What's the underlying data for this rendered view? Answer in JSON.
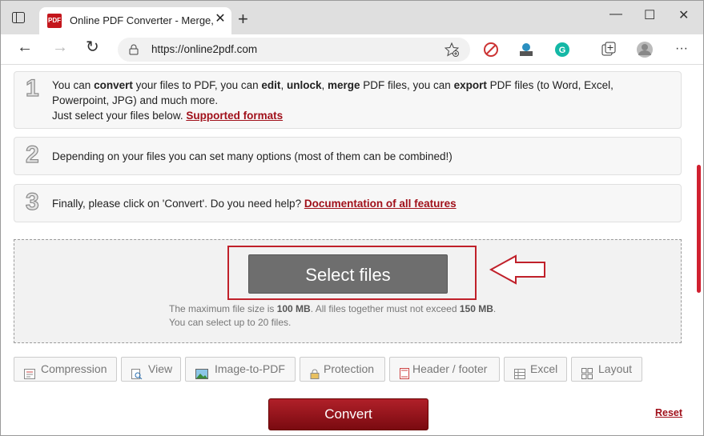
{
  "browser": {
    "tab_title": "Online PDF Converter - Merge, c",
    "favicon_text": "PDF",
    "url": "https://online2pdf.com"
  },
  "steps": [
    {
      "number": "1",
      "t1": "You can ",
      "b1": "convert",
      "t2": " your files to PDF, you can ",
      "b2": "edit",
      "t3": ", ",
      "b3": "unlock",
      "t4": ", ",
      "b4": "merge",
      "t5": " PDF files, you can ",
      "b5": "export",
      "t6": " PDF files (to Word, Excel,",
      "line2": "Powerpoint, JPG) and much more.",
      "line3": "Just select your files below. ",
      "link": "Supported formats"
    },
    {
      "number": "2",
      "text": "Depending on your files you can set many options (most of them can be combined!)"
    },
    {
      "number": "3",
      "text": "Finally, please click on 'Convert'. Do you need help? ",
      "link": "Documentation of all features"
    }
  ],
  "upload": {
    "button_label": "Select files",
    "info1_a": "The maximum file size is ",
    "info1_b": "100 MB",
    "info1_c": ". All files together must not exceed ",
    "info1_d": "150 MB",
    "info1_e": ".",
    "info2": "You can select up to 20 files."
  },
  "options": [
    {
      "label": "Compression",
      "icon": "compression-icon"
    },
    {
      "label": "View",
      "icon": "view-icon"
    },
    {
      "label": "Image-to-PDF",
      "icon": "image-icon"
    },
    {
      "label": "Protection",
      "icon": "lock-icon"
    },
    {
      "label": "Header / footer",
      "icon": "header-footer-icon"
    },
    {
      "label": "Excel",
      "icon": "excel-icon"
    },
    {
      "label": "Layout",
      "icon": "layout-icon"
    }
  ],
  "actions": {
    "convert_label": "Convert",
    "reset_label": "Reset"
  },
  "colors": {
    "accent": "#a0101a",
    "convert_top": "#b02029",
    "convert_bottom": "#7a0a10",
    "select_button": "#6e6e6e",
    "highlight_box": "#c0202a"
  }
}
